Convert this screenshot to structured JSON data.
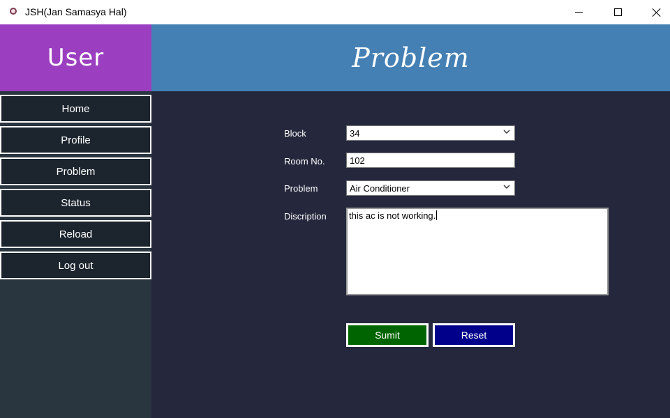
{
  "window": {
    "title": "JSH(Jan Samasya Hal)"
  },
  "header": {
    "user_label": "User",
    "page_title": "Problem"
  },
  "sidebar": {
    "items": [
      {
        "label": "Home"
      },
      {
        "label": "Profile"
      },
      {
        "label": "Problem"
      },
      {
        "label": "Status"
      },
      {
        "label": "Reload"
      },
      {
        "label": "Log out"
      }
    ]
  },
  "form": {
    "block": {
      "label": "Block",
      "value": "34"
    },
    "room": {
      "label": "Room No.",
      "value": "102"
    },
    "problem": {
      "label": "Problem",
      "value": "Air Conditioner"
    },
    "description": {
      "label": "Discription",
      "value": "this ac is not working."
    },
    "submit_label": "Sumit",
    "reset_label": "Reset"
  },
  "colors": {
    "user_header_bg": "#9b3fc0",
    "page_header_bg": "#4480b4",
    "sidebar_bg": "#29353f",
    "nav_button_bg": "#1c252e",
    "main_bg": "#25283d",
    "submit_bg": "#006400",
    "reset_bg": "#00008b"
  },
  "icons": {
    "app": "app-icon",
    "minimize": "minimize-icon",
    "maximize": "maximize-icon",
    "close": "close-icon",
    "dropdown": "chevron-down-icon"
  }
}
